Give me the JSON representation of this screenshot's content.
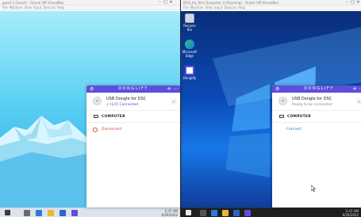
{
  "left_vm": {
    "title": "guest 1 (Guest) - Oracle VM VirtualBox",
    "menu": [
      "File",
      "Machine",
      "View",
      "Input",
      "Devices",
      "Help"
    ],
    "taskbar": {
      "time": "5:47 AM",
      "date": "6/29/2022"
    }
  },
  "right_vm": {
    "title": "W10_64_Test (Snapshot 1) [Running] - Oracle VM VirtualBox",
    "menu": [
      "File",
      "Machine",
      "View",
      "Input",
      "Devices",
      "Help"
    ],
    "desktop_icons": [
      {
        "label": "Recycle Bin",
        "icon": "recycle-bin-icon"
      },
      {
        "label": "Microsoft Edge",
        "icon": "edge-icon"
      },
      {
        "label": "Donglify",
        "icon": "donglify-icon"
      }
    ],
    "taskbar": {
      "time": "5:47 AM",
      "date": "6/29/2022"
    }
  },
  "panel_left": {
    "brand": "DONGLIFY",
    "device_name": "USB Dongle for DSC",
    "device_status": "(1/2) Connected",
    "section": "COMPUTER",
    "action": "Disconnect"
  },
  "panel_right": {
    "brand": "DONGLIFY",
    "device_name": "USB Dongle for DSC",
    "device_status": "Ready to be connected",
    "section": "COMPUTER",
    "action": "Connect"
  },
  "colors": {
    "accent": "#5d4fdb",
    "connected": "#6a3ad8",
    "disconnect": "#e23b3b",
    "connect": "#2f73d9"
  }
}
